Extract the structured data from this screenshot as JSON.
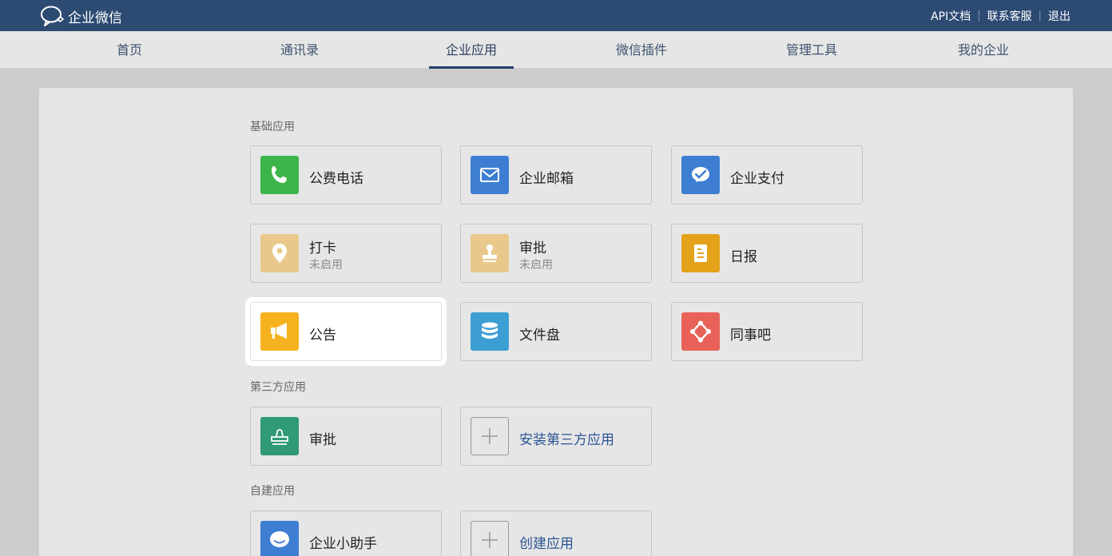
{
  "header": {
    "brand": "企业微信",
    "links": [
      "API文档",
      "联系客服",
      "退出"
    ],
    "separator": "|"
  },
  "nav": {
    "items": [
      "首页",
      "通讯录",
      "企业应用",
      "微信插件",
      "管理工具",
      "我的企业"
    ],
    "active_index": 2
  },
  "sections": {
    "basic": "基础应用",
    "third_party": "第三方应用",
    "custom": "自建应用"
  },
  "apps": {
    "call": {
      "label": "公费电话",
      "icon": "phone-icon",
      "color": "#3cb54a"
    },
    "mail": {
      "label": "企业邮箱",
      "icon": "mail-icon",
      "color": "#3d7ed3"
    },
    "pay": {
      "label": "企业支付",
      "icon": "payment-icon",
      "color": "#3d7ed3"
    },
    "checkin": {
      "label": "打卡",
      "sub": "未启用",
      "icon": "location-pin-icon",
      "color": "#e9c98b"
    },
    "approval_basic": {
      "label": "审批",
      "sub": "未启用",
      "icon": "stamp-icon",
      "color": "#e9c98b"
    },
    "daily": {
      "label": "日报",
      "icon": "report-icon",
      "color": "#e3a21a"
    },
    "notice": {
      "label": "公告",
      "icon": "megaphone-icon",
      "color": "#f6b21e"
    },
    "drive": {
      "label": "文件盘",
      "icon": "database-icon",
      "color": "#3d9ed3"
    },
    "bar": {
      "label": "同事吧",
      "icon": "network-icon",
      "color": "#e8625a"
    },
    "approval_third": {
      "label": "审批",
      "icon": "stamp-outline-icon",
      "color": "#2f9a74"
    },
    "install_third": {
      "label": "安装第三方应用",
      "icon": "plus-icon"
    },
    "assistant": {
      "label": "企业小助手",
      "icon": "chat-bubble-icon",
      "color": "#3d7ed3"
    },
    "create": {
      "label": "创建应用",
      "icon": "plus-icon"
    }
  }
}
